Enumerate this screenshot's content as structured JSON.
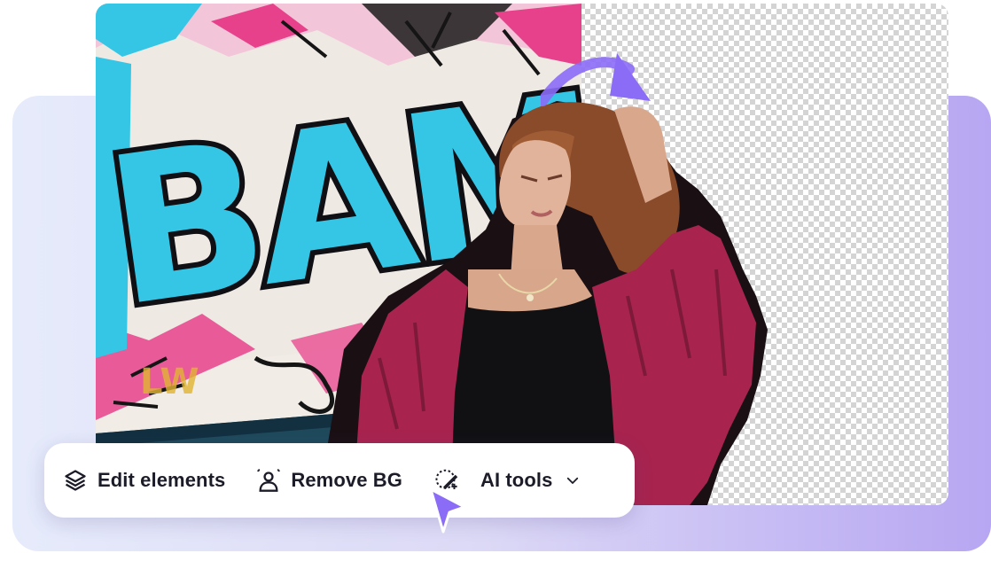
{
  "toolbar": {
    "edit_label": "Edit elements",
    "remove_label": "Remove BG",
    "ai_label": "AI tools"
  },
  "icons": {
    "edit": "layers-icon",
    "remove": "person-cutout-icon",
    "ai": "magic-wand-icon",
    "dropdown": "chevron-down-icon",
    "cursor": "pointer-cursor-icon",
    "arrow": "curved-arrow-icon"
  },
  "photo": {
    "graffiti_text": "BAM"
  },
  "colors": {
    "accent": "#8b6cf6",
    "backdrop_start": "#e6ebfb",
    "backdrop_end": "#b7a6f2",
    "graffiti_cyan": "#35c6e6",
    "graffiti_pink": "#e8418b",
    "shirt": "#a8244f"
  }
}
